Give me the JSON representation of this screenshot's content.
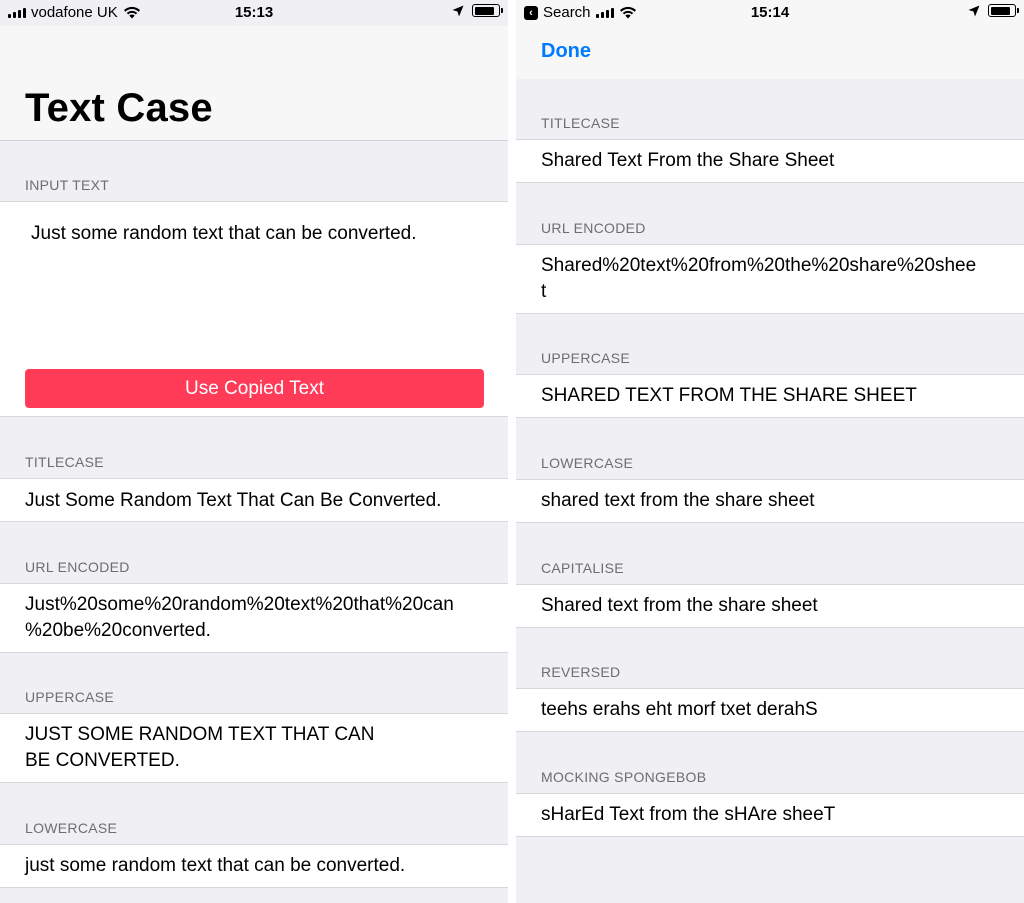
{
  "left": {
    "status": {
      "carrier": "vodafone UK",
      "time": "15:13"
    },
    "title": "Text Case",
    "input": {
      "label": "INPUT TEXT",
      "value": "Just some random text that can be converted.",
      "button_label": "Use Copied Text"
    },
    "sections": [
      {
        "label": "TITLECASE",
        "text": "Just Some Random Text That Can Be Converted."
      },
      {
        "label": "URL ENCODED",
        "line1": "Just%20some%20random%20text%20that%20can",
        "line2": "%20be%20converted."
      },
      {
        "label": "UPPERCASE",
        "line1": "JUST SOME RANDOM TEXT THAT CAN",
        "line2": "BE CONVERTED."
      },
      {
        "label": "LOWERCASE",
        "text": "just some random text that can be converted."
      }
    ]
  },
  "right": {
    "status": {
      "back_label": "Search",
      "time": "15:14"
    },
    "nav": {
      "done_label": "Done"
    },
    "sections": [
      {
        "label": "TITLECASE",
        "text": "Shared Text From the Share Sheet"
      },
      {
        "label": "URL ENCODED",
        "line1": "Shared%20text%20from%20the%20share%20shee",
        "line2": "t"
      },
      {
        "label": "UPPERCASE",
        "text": "SHARED TEXT FROM THE SHARE SHEET"
      },
      {
        "label": "LOWERCASE",
        "text": "shared text from the share sheet"
      },
      {
        "label": "CAPITALISE",
        "text": "Shared text from the share sheet"
      },
      {
        "label": "REVERSED",
        "text": "teehs erahs eht morf txet derahS"
      },
      {
        "label": "MOCKING SPONGEBOB",
        "text": "sHarEd Text from the sHAre sheeT"
      }
    ]
  },
  "colors": {
    "accent": "#007aff",
    "button": "#ff3b58",
    "background": "#efeff4",
    "label": "#6d6d72"
  },
  "icons": [
    "signal-icon",
    "wifi-icon",
    "location-icon",
    "battery-icon",
    "back-chevron-icon"
  ]
}
